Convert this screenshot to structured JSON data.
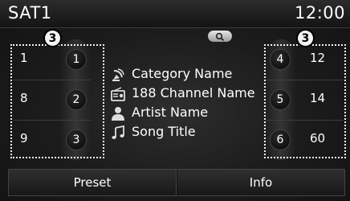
{
  "header": {
    "title": "SAT1",
    "clock": "12:00"
  },
  "scan_icon": "search-icon",
  "callouts": {
    "left": "3",
    "right": "3"
  },
  "left_presets": [
    {
      "frequency": "1",
      "button": "1"
    },
    {
      "frequency": "8",
      "button": "2"
    },
    {
      "frequency": "9",
      "button": "3"
    }
  ],
  "right_presets": [
    {
      "button": "4",
      "frequency": "12"
    },
    {
      "button": "5",
      "frequency": "14"
    },
    {
      "button": "6",
      "frequency": "60"
    }
  ],
  "info": {
    "category": "Category Name",
    "channel": "188 Channel Name",
    "artist": "Artist Name",
    "song": "Song Title"
  },
  "buttons": {
    "preset": "Preset",
    "info": "Info"
  }
}
